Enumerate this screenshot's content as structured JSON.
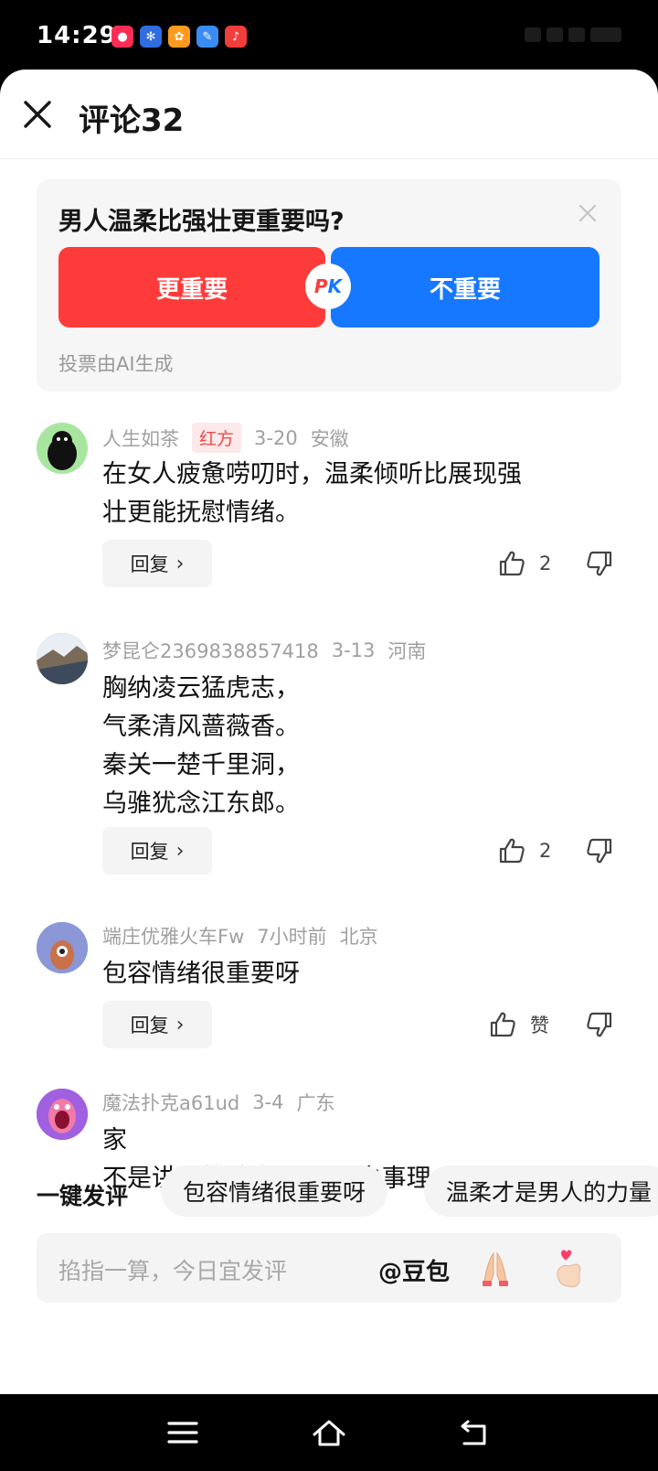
{
  "status_bar": {
    "time": "14:29",
    "app_icons": [
      {
        "name": "red-play-app-icon",
        "color": "#ff2d55",
        "glyph": "●"
      },
      {
        "name": "baidu-paw-app-icon",
        "color": "#2f6de0",
        "glyph": "✻"
      },
      {
        "name": "orange-squirrel-app-icon",
        "color": "#ff9a1f",
        "glyph": "✿"
      },
      {
        "name": "blue-feather-app-icon",
        "color": "#3a8cf5",
        "glyph": "✎"
      },
      {
        "name": "red-music-app-icon",
        "color": "#f23d3d",
        "glyph": "♪"
      }
    ]
  },
  "header": {
    "title": "评论32",
    "close_icon": "close-icon"
  },
  "vote": {
    "question": "男人温柔比强壮更重要吗?",
    "option_a": "更重要",
    "option_b": "不重要",
    "pk_p": "P",
    "pk_k": "K",
    "footnote": "投票由AI生成",
    "colors": {
      "option_a": "#fe3b3b",
      "option_b": "#1677ff"
    }
  },
  "comments": [
    {
      "username": "人生如茶",
      "tag": "红方",
      "date": "3-20",
      "location": "安徽",
      "lines": [
        "在女人疲惫唠叨时，温柔倾听比展现强",
        "壮更能抚慰情绪。"
      ],
      "reply_label": "回复",
      "like_label": "2"
    },
    {
      "username": "梦昆仑2369838857418",
      "date": "3-13",
      "location": "河南",
      "lines": [
        "胸纳凌云猛虎志，",
        "气柔清风蔷薇香。",
        "秦关一楚千里洞，",
        "乌骓犹念江东郎。"
      ],
      "reply_label": "回复",
      "like_label": "2"
    },
    {
      "username": "端庄优雅火车Fw",
      "date": "7小时前",
      "location": "北京",
      "lines": [
        "包容情绪很重要呀"
      ],
      "reply_label": "回复",
      "like_label": "赞"
    },
    {
      "username": "魔法扑克a61ud",
      "date": "3-4",
      "location": "广东",
      "lines": [
        "家",
        "不是讲理的地方 但要明白事理"
      ]
    }
  ],
  "quick_reply": {
    "label": "一键发评",
    "chips": [
      "包容情绪很重要呀",
      "温柔才是男人的力量"
    ]
  },
  "input": {
    "placeholder": "掐指一算，今日宜发评",
    "mention": "@豆包",
    "emoji_1": "pray-emoji-icon",
    "emoji_2": "finger-heart-emoji-icon"
  },
  "nav_bar": {
    "icons": [
      "menu-icon",
      "home-icon",
      "back-icon"
    ]
  }
}
